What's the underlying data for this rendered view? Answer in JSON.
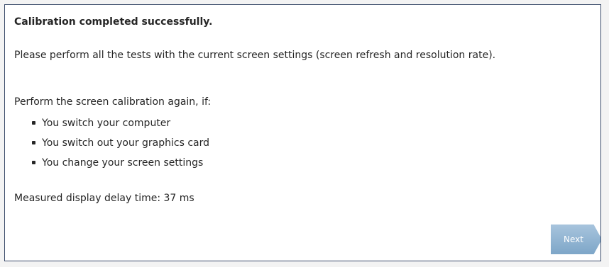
{
  "dialog": {
    "title": "Calibration completed successfully.",
    "paragraph": "Please perform all the tests with the current screen settings (screen refresh and resolution rate).",
    "intro": "Perform the screen calibration again, if:",
    "items": [
      "You switch your computer",
      "You switch out your graphics card",
      "You change your screen settings"
    ],
    "measured": "Measured display delay time: 37 ms",
    "next_label": "Next"
  },
  "colors": {
    "border": "#3a4b6a",
    "button": "#8fb2d2",
    "text": "#262626"
  }
}
